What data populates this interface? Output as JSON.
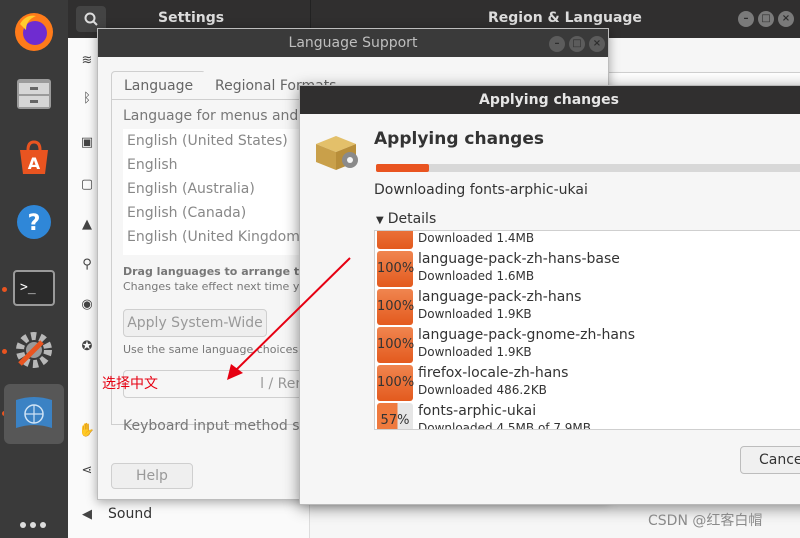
{
  "settings": {
    "title": "Settings",
    "panel_title": "Region & Language",
    "sound_label": "Sound"
  },
  "language_support": {
    "title": "Language Support",
    "tabs": [
      "Language",
      "Regional Formats"
    ],
    "menus_label": "Language for menus and w",
    "languages": [
      "English (United States)",
      "English",
      "English (Australia)",
      "English (Canada)",
      "English (United Kingdom)"
    ],
    "drag_hint": "Drag languages to arrange ther",
    "changes_hint": "Changes take effect next time y",
    "apply_button": "Apply System-Wide",
    "same_language_hint": "Use the same language choices f",
    "install_remove_button": "l / Remove Language",
    "keyboard_label": "Keyboard input method sy",
    "help_button": "Help"
  },
  "applying": {
    "window_title": "Applying changes",
    "heading": "Applying changes",
    "progress_fraction": 0.12,
    "downloading": "Downloading fonts-arphic-ukai",
    "details_label": "Details",
    "partial_row_sub": "Downloaded 1.4MB",
    "packages": [
      {
        "percent": "100%",
        "name": "language-pack-zh-hans-base",
        "status": "Downloaded 1.6MB"
      },
      {
        "percent": "100%",
        "name": "language-pack-zh-hans",
        "status": "Downloaded 1.9KB"
      },
      {
        "percent": "100%",
        "name": "language-pack-gnome-zh-hans",
        "status": "Downloaded 1.9KB"
      },
      {
        "percent": "100%",
        "name": "firefox-locale-zh-hans",
        "status": "Downloaded 486.2KB"
      },
      {
        "percent": "57%",
        "name": "fonts-arphic-ukai",
        "status": "Downloaded 4.5MB of 7.9MB"
      }
    ],
    "cancel_button": "Cance"
  },
  "annotation": {
    "text": "选择中文",
    "color": "#e60012"
  },
  "watermark": "CSDN @红客白帽",
  "colors": {
    "accent": "#e95420",
    "dock": "#3a3a3a",
    "titlebar": "#302f2f"
  }
}
